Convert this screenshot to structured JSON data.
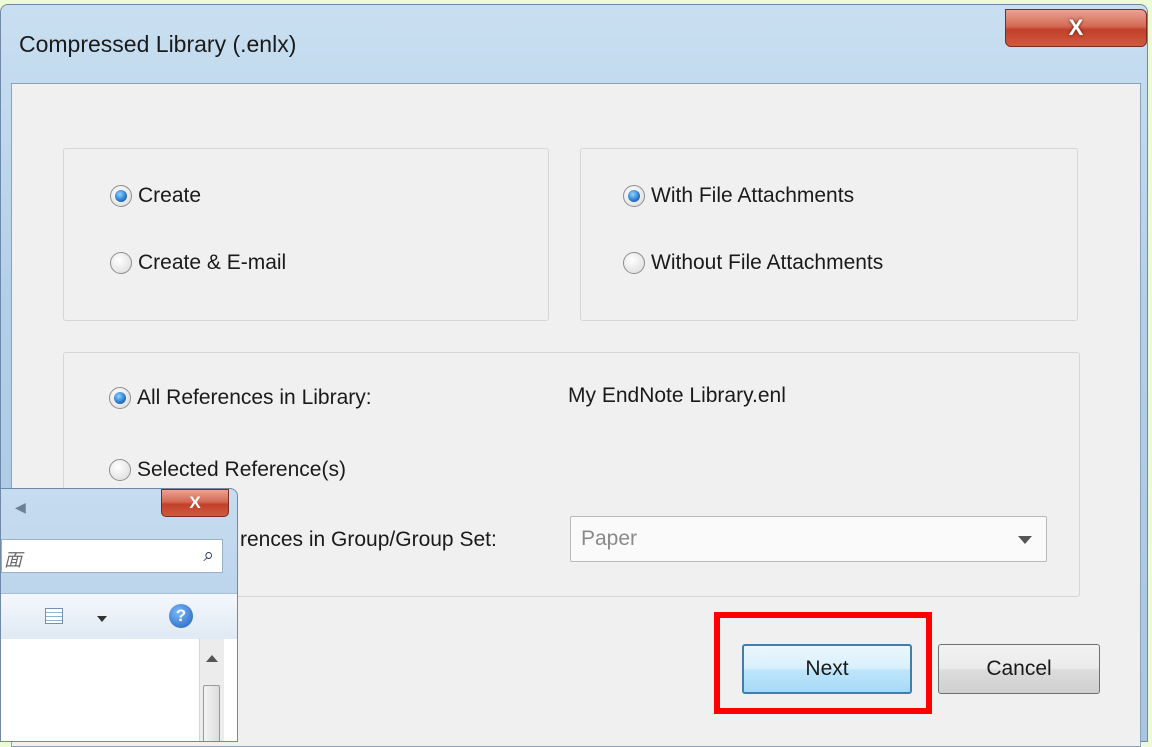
{
  "dialog": {
    "title": "Compressed Library (.enlx)",
    "close_glyph": "X"
  },
  "create_group": {
    "options": [
      {
        "label": "Create",
        "checked": true
      },
      {
        "label": "Create & E-mail",
        "checked": false
      }
    ]
  },
  "attachments_group": {
    "options": [
      {
        "label": "With File Attachments",
        "checked": true
      },
      {
        "label": "Without File Attachments",
        "checked": false
      }
    ]
  },
  "references_group": {
    "all_label": "All References in Library:",
    "library_name": "My EndNote Library.enl",
    "selected_label": "Selected Reference(s)",
    "group_label": "rences in Group/Group Set:",
    "group_value": "Paper"
  },
  "buttons": {
    "next": "Next",
    "cancel": "Cancel"
  },
  "highlight_color": "#ff0000",
  "background_window": {
    "close_glyph": "X",
    "search_text": "面",
    "icons": [
      "back-icon",
      "search-icon",
      "view-icon",
      "help-icon"
    ]
  }
}
